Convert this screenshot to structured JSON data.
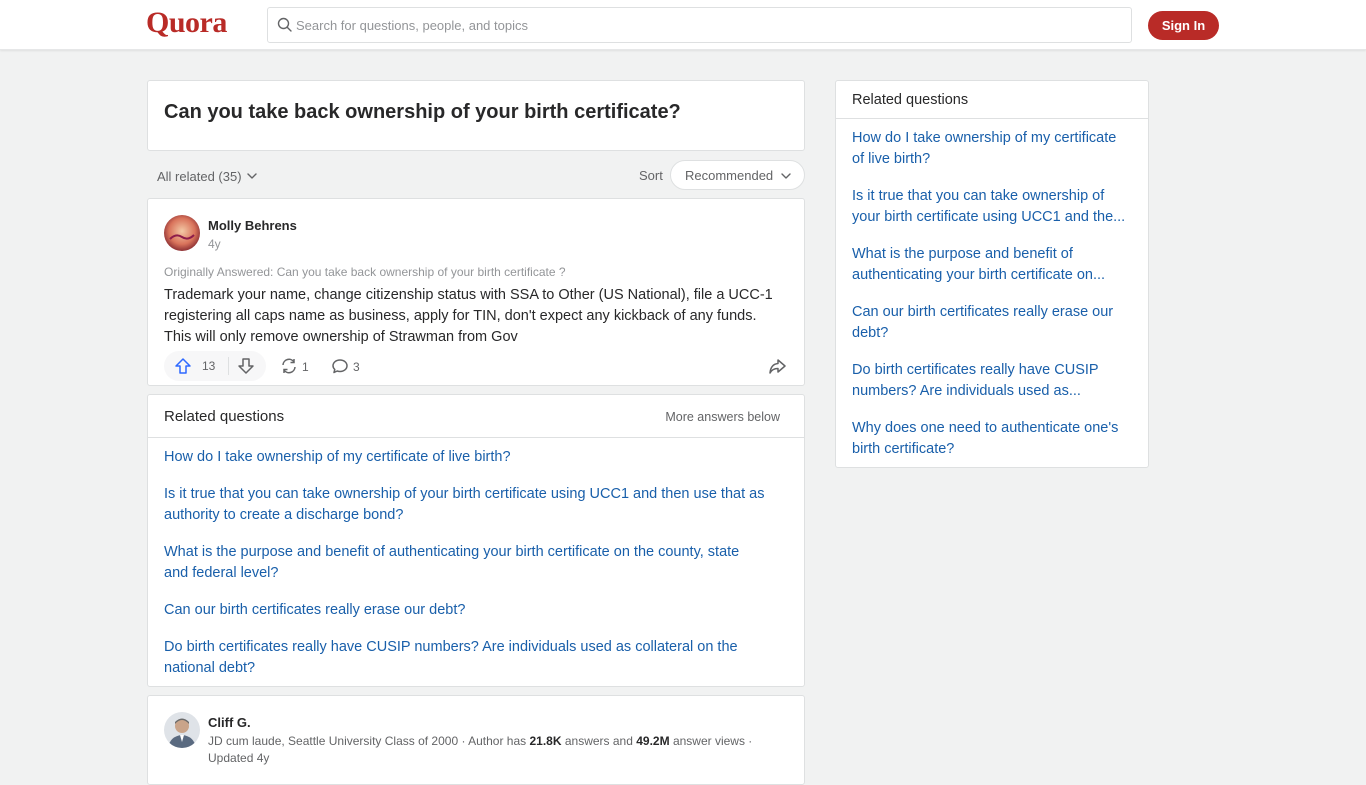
{
  "header": {
    "logo": "Quora",
    "search_placeholder": "Search for questions, people, and topics",
    "signin_label": "Sign In"
  },
  "question": {
    "title": "Can you take back ownership of your birth certificate?"
  },
  "filters": {
    "all_related": "All related (35)",
    "sort_label": "Sort",
    "sort_value": "Recommended"
  },
  "answer1": {
    "author": "Molly Behrens",
    "time": "4y",
    "originally_answered": "Originally Answered: Can you take back ownership of your birth certificate ?",
    "body_lines": [
      "Trademark your name, change citizenship status with SSA to Other (US National), file a UCC-1",
      "registering all caps name as business, apply for TIN, don't expect any kickback of any funds.",
      "This will only remove ownership of Strawman from Gov"
    ],
    "upvotes": "13",
    "shares": "1",
    "comments": "3"
  },
  "related_inline": {
    "heading": "Related questions",
    "more": "More answers below",
    "items": [
      [
        "How do I take ownership of my certificate of live birth?"
      ],
      [
        "Is it true that you can take ownership of your birth certificate using UCC1 and then use that as",
        "authority to create a discharge bond?"
      ],
      [
        "What is the purpose and benefit of authenticating your birth certificate on the county, state",
        "and federal level?"
      ],
      [
        "Can our birth certificates really erase our debt?"
      ],
      [
        "Do birth certificates really have CUSIP numbers? Are individuals used as collateral on the",
        "national debt?"
      ]
    ]
  },
  "answer2": {
    "author": "Cliff G.",
    "cred_prefix": "JD cum laude, Seattle University Class of 2000 · Author has ",
    "answers_count": "21.8K",
    "cred_mid": " answers and ",
    "views_count": "49.2M",
    "cred_suffix": " answer views ·",
    "updated": "Updated 4y"
  },
  "sidebar": {
    "heading": "Related questions",
    "items": [
      [
        "How do I take ownership of my certificate",
        "of live birth?"
      ],
      [
        "Is it true that you can take ownership of",
        "your birth certificate using UCC1 and the..."
      ],
      [
        "What is the purpose and benefit of",
        "authenticating your birth certificate on..."
      ],
      [
        "Can our birth certificates really erase our",
        "debt?"
      ],
      [
        "Do birth certificates really have CUSIP",
        "numbers? Are individuals used as..."
      ],
      [
        "Why does one need to authenticate one's",
        "birth certificate?"
      ]
    ]
  },
  "colors": {
    "brand": "#b92b27",
    "link": "#195faa",
    "upvote": "#2e69ff"
  }
}
